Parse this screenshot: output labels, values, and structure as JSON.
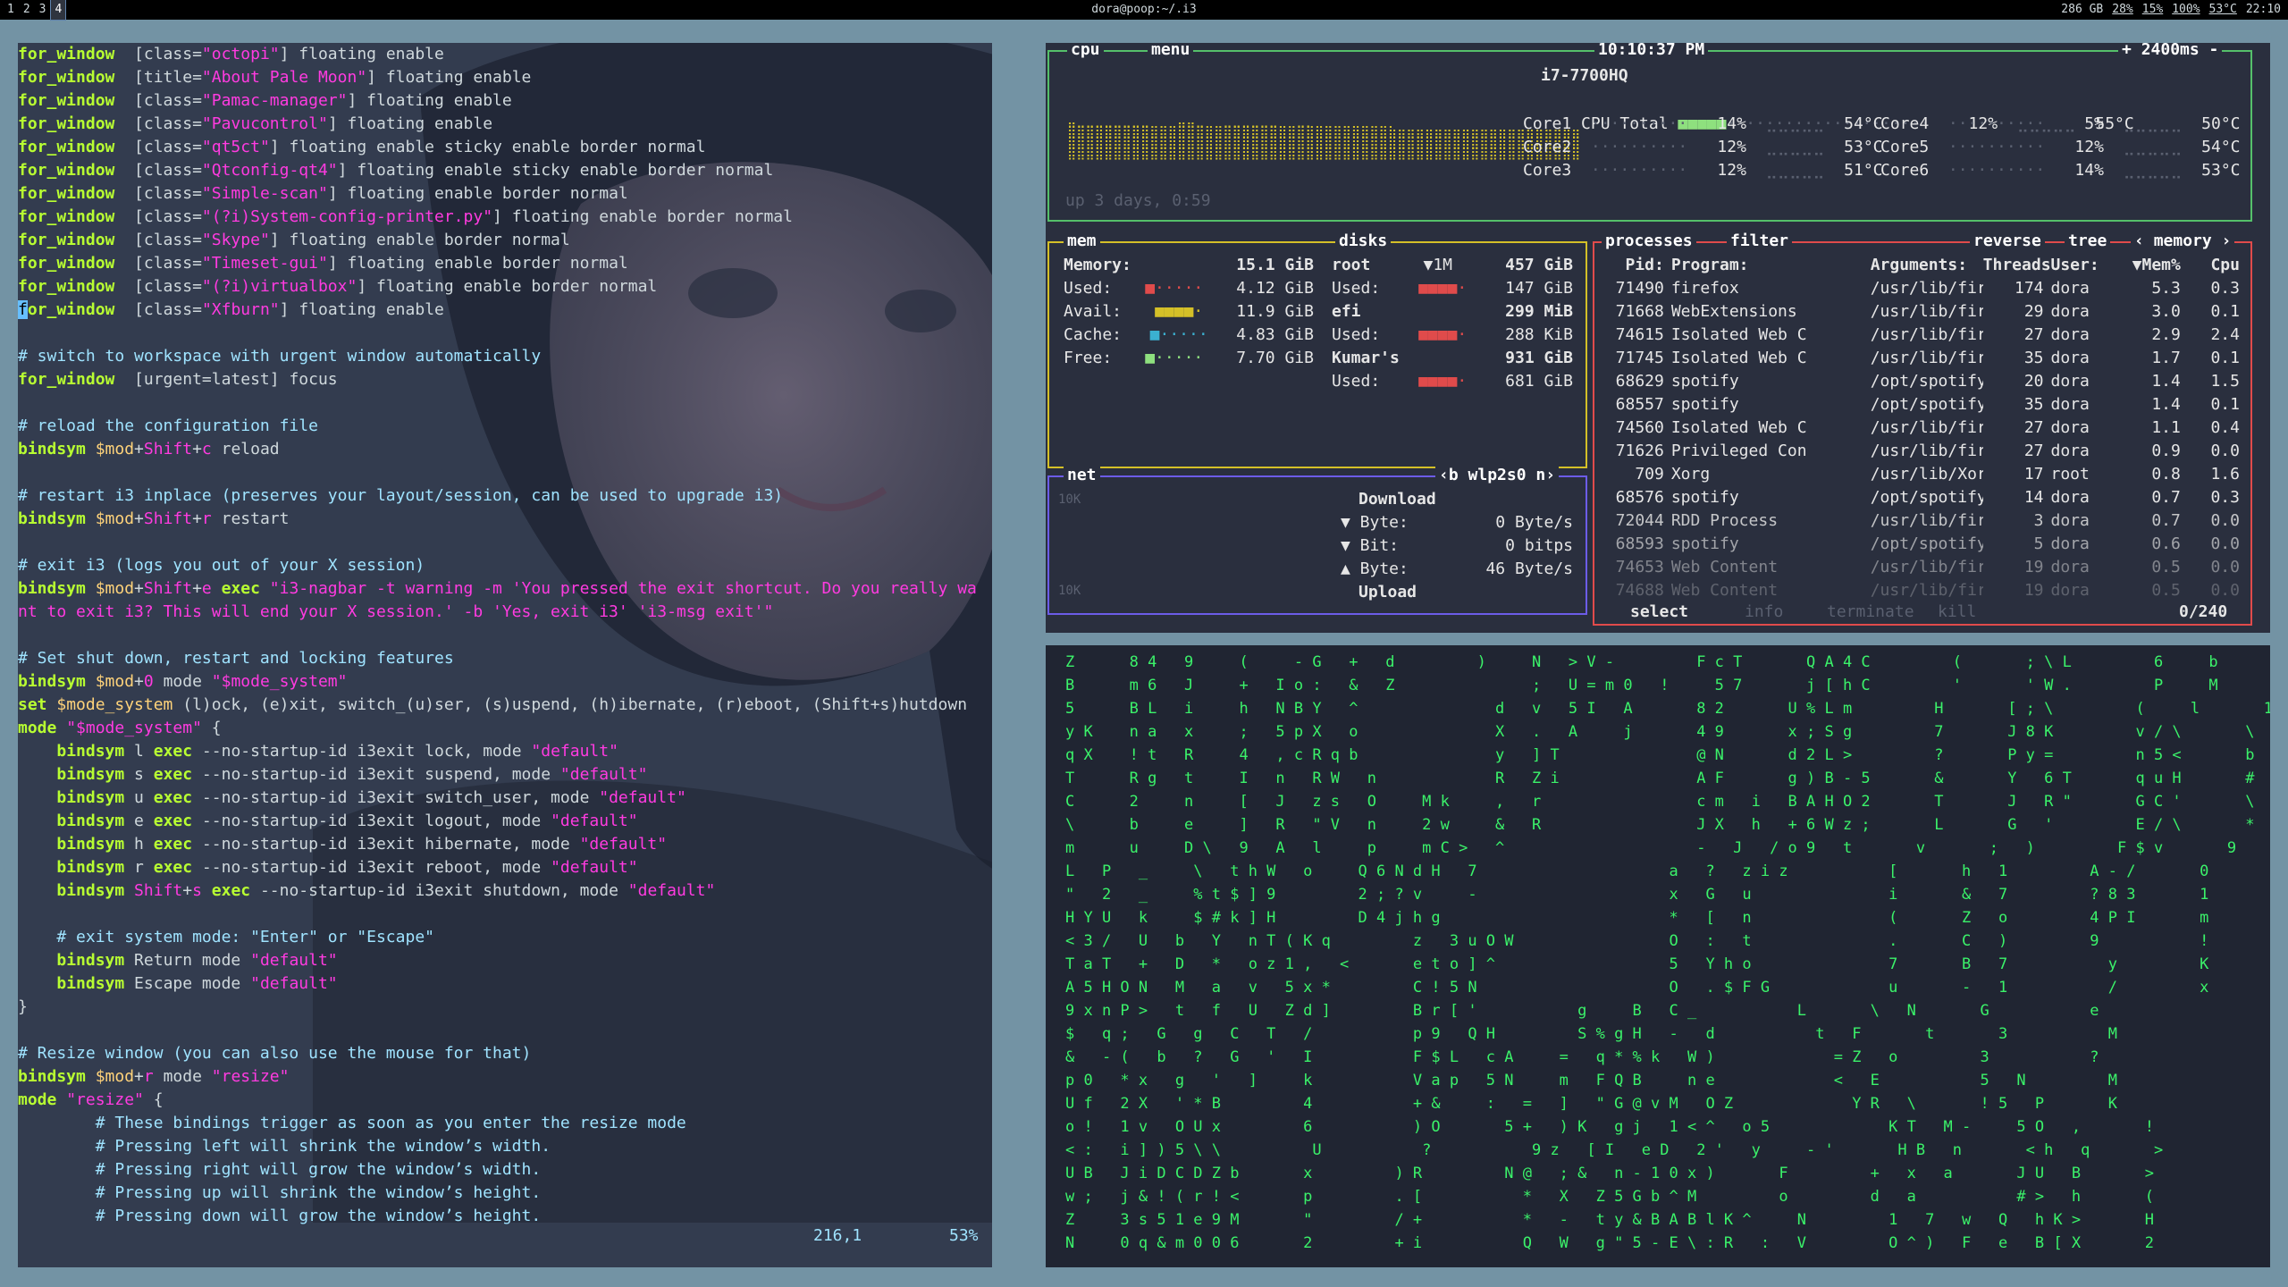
{
  "bar": {
    "workspaces": [
      "1",
      "2",
      "3",
      "4"
    ],
    "active_workspace": "4",
    "title": "dora@poop:~/.i3",
    "status": [
      "286 GB",
      "28%",
      "15%",
      "100%",
      "53°C",
      "22:10"
    ]
  },
  "editor": {
    "lines": [
      [
        [
          "kw",
          "for_window"
        ],
        [
          "",
          "  [class="
        ],
        [
          "str",
          "\"octopi\""
        ],
        [
          "",
          "] floating enable"
        ]
      ],
      [
        [
          "kw",
          "for_window"
        ],
        [
          "",
          "  [title="
        ],
        [
          "str",
          "\"About Pale Moon\""
        ],
        [
          "",
          "] floating enable"
        ]
      ],
      [
        [
          "kw",
          "for_window"
        ],
        [
          "",
          "  [class="
        ],
        [
          "str",
          "\"Pamac-manager\""
        ],
        [
          "",
          "] floating enable"
        ]
      ],
      [
        [
          "kw",
          "for_window"
        ],
        [
          "",
          "  [class="
        ],
        [
          "str",
          "\"Pavucontrol\""
        ],
        [
          "",
          "] floating enable"
        ]
      ],
      [
        [
          "kw",
          "for_window"
        ],
        [
          "",
          "  [class="
        ],
        [
          "str",
          "\"qt5ct\""
        ],
        [
          "",
          "] floating enable sticky enable border normal"
        ]
      ],
      [
        [
          "kw",
          "for_window"
        ],
        [
          "",
          "  [class="
        ],
        [
          "str",
          "\"Qtconfig-qt4\""
        ],
        [
          "",
          "] floating enable sticky enable border normal"
        ]
      ],
      [
        [
          "kw",
          "for_window"
        ],
        [
          "",
          "  [class="
        ],
        [
          "str",
          "\"Simple-scan\""
        ],
        [
          "",
          "] floating enable border normal"
        ]
      ],
      [
        [
          "kw",
          "for_window"
        ],
        [
          "",
          "  [class="
        ],
        [
          "str",
          "\"(?i)System-config-printer.py\""
        ],
        [
          "",
          "] floating enable border normal"
        ]
      ],
      [
        [
          "kw",
          "for_window"
        ],
        [
          "",
          "  [class="
        ],
        [
          "str",
          "\"Skype\""
        ],
        [
          "",
          "] floating enable border normal"
        ]
      ],
      [
        [
          "kw",
          "for_window"
        ],
        [
          "",
          "  [class="
        ],
        [
          "str",
          "\"Timeset-gui\""
        ],
        [
          "",
          "] floating enable border normal"
        ]
      ],
      [
        [
          "kw",
          "for_window"
        ],
        [
          "",
          "  [class="
        ],
        [
          "str",
          "\"(?i)virtualbox\""
        ],
        [
          "",
          "] floating enable border normal"
        ]
      ],
      [
        [
          "cursor",
          "f"
        ],
        [
          "kw",
          "or_window"
        ],
        [
          "",
          "  [class="
        ],
        [
          "str",
          "\"Xfburn\""
        ],
        [
          "",
          "] floating enable"
        ]
      ],
      [],
      [
        [
          "cm",
          "# switch to workspace with urgent window automatically"
        ]
      ],
      [
        [
          "kw",
          "for_window"
        ],
        [
          "",
          "  [urgent=latest] focus"
        ]
      ],
      [],
      [
        [
          "cm",
          "# reload the configuration file"
        ]
      ],
      [
        [
          "kw",
          "bindsym"
        ],
        [
          "var",
          " $mod"
        ],
        [
          "",
          "+"
        ],
        [
          "str",
          "Shift"
        ],
        [
          "",
          "+"
        ],
        [
          "str",
          "c"
        ],
        [
          "",
          " reload"
        ]
      ],
      [],
      [
        [
          "cm",
          "# restart i3 inplace (preserves your layout/session, can be used to upgrade i3)"
        ]
      ],
      [
        [
          "kw",
          "bindsym"
        ],
        [
          "var",
          " $mod"
        ],
        [
          "",
          "+"
        ],
        [
          "str",
          "Shift"
        ],
        [
          "",
          "+"
        ],
        [
          "str",
          "r"
        ],
        [
          "",
          " restart"
        ]
      ],
      [],
      [
        [
          "cm",
          "# exit i3 (logs you out of your X session)"
        ]
      ],
      [
        [
          "kw",
          "bindsym"
        ],
        [
          "var",
          " $mod"
        ],
        [
          "",
          "+"
        ],
        [
          "str",
          "Shift"
        ],
        [
          "",
          "+"
        ],
        [
          "str",
          "e"
        ],
        [
          "kw",
          " exec"
        ],
        [
          "str",
          " \"i3-nagbar -t warning -m 'You pressed the exit shortcut. Do you really wa"
        ]
      ],
      [
        [
          "str",
          "nt to exit i3? This will end your X session.' -b 'Yes, exit i3' 'i3-msg exit'\""
        ]
      ],
      [],
      [
        [
          "cm",
          "# Set shut down, restart and locking features"
        ]
      ],
      [
        [
          "kw",
          "bindsym"
        ],
        [
          "var",
          " $mod"
        ],
        [
          "",
          "+"
        ],
        [
          "str",
          "0"
        ],
        [
          "",
          " mode "
        ],
        [
          "str",
          "\"$mode_system\""
        ]
      ],
      [
        [
          "kw",
          "set"
        ],
        [
          "var",
          " $mode_system"
        ],
        [
          "",
          " (l)ock, (e)xit, switch_(u)ser, (s)uspend, (h)ibernate, (r)eboot, (Shift+s)hutdown"
        ]
      ],
      [
        [
          "kw",
          "mode"
        ],
        [
          "str",
          " \"$mode_system\""
        ],
        [
          "",
          " {"
        ]
      ],
      [
        [
          "",
          "    "
        ],
        [
          "kw",
          "bindsym"
        ],
        [
          "",
          " l "
        ],
        [
          "kw",
          "exec"
        ],
        [
          "",
          " --no-startup-id i3exit lock, mode "
        ],
        [
          "str",
          "\"default\""
        ]
      ],
      [
        [
          "",
          "    "
        ],
        [
          "kw",
          "bindsym"
        ],
        [
          "",
          " s "
        ],
        [
          "kw",
          "exec"
        ],
        [
          "",
          " --no-startup-id i3exit suspend, mode "
        ],
        [
          "str",
          "\"default\""
        ]
      ],
      [
        [
          "",
          "    "
        ],
        [
          "kw",
          "bindsym"
        ],
        [
          "",
          " u "
        ],
        [
          "kw",
          "exec"
        ],
        [
          "",
          " --no-startup-id i3exit switch_user, mode "
        ],
        [
          "str",
          "\"default\""
        ]
      ],
      [
        [
          "",
          "    "
        ],
        [
          "kw",
          "bindsym"
        ],
        [
          "",
          " e "
        ],
        [
          "kw",
          "exec"
        ],
        [
          "",
          " --no-startup-id i3exit logout, mode "
        ],
        [
          "str",
          "\"default\""
        ]
      ],
      [
        [
          "",
          "    "
        ],
        [
          "kw",
          "bindsym"
        ],
        [
          "",
          " h "
        ],
        [
          "kw",
          "exec"
        ],
        [
          "",
          " --no-startup-id i3exit hibernate, mode "
        ],
        [
          "str",
          "\"default\""
        ]
      ],
      [
        [
          "",
          "    "
        ],
        [
          "kw",
          "bindsym"
        ],
        [
          "",
          " r "
        ],
        [
          "kw",
          "exec"
        ],
        [
          "",
          " --no-startup-id i3exit reboot, mode "
        ],
        [
          "str",
          "\"default\""
        ]
      ],
      [
        [
          "",
          "    "
        ],
        [
          "kw",
          "bindsym"
        ],
        [
          "str",
          " Shift"
        ],
        [
          "",
          "+"
        ],
        [
          "str",
          "s"
        ],
        [
          "kw",
          " exec"
        ],
        [
          "",
          " --no-startup-id i3exit shutdown, mode "
        ],
        [
          "str",
          "\"default\""
        ]
      ],
      [],
      [
        [
          "cm",
          "    # exit system mode: \"Enter\" or \"Escape\""
        ]
      ],
      [
        [
          "",
          "    "
        ],
        [
          "kw",
          "bindsym"
        ],
        [
          "",
          " Return mode "
        ],
        [
          "str",
          "\"default\""
        ]
      ],
      [
        [
          "",
          "    "
        ],
        [
          "kw",
          "bindsym"
        ],
        [
          "",
          " Escape mode "
        ],
        [
          "str",
          "\"default\""
        ]
      ],
      [
        [
          "",
          "}"
        ]
      ],
      [],
      [
        [
          "cm",
          "# Resize window (you can also use the mouse for that)"
        ]
      ],
      [
        [
          "kw",
          "bindsym"
        ],
        [
          "var",
          " $mod"
        ],
        [
          "",
          "+"
        ],
        [
          "str",
          "r"
        ],
        [
          "",
          " mode "
        ],
        [
          "str",
          "\"resize\""
        ]
      ],
      [
        [
          "kw",
          "mode"
        ],
        [
          "str",
          " \"resize\""
        ],
        [
          "",
          " {"
        ]
      ],
      [
        [
          "cm",
          "        # These bindings trigger as soon as you enter the resize mode"
        ]
      ],
      [
        [
          "cm",
          "        # Pressing left will shrink the window’s width."
        ]
      ],
      [
        [
          "cm",
          "        # Pressing right will grow the window’s width."
        ]
      ],
      [
        [
          "cm",
          "        # Pressing up will shrink the window’s height."
        ]
      ],
      [
        [
          "cm",
          "        # Pressing down will grow the window’s height."
        ]
      ]
    ],
    "position": "216,1",
    "percent": "53%"
  },
  "bpytop": {
    "cpu": {
      "tabs": [
        "cpu",
        "menu"
      ],
      "clock": "10:10:37 PM",
      "interval": "2400ms",
      "model": "i7-7700HQ",
      "total_label": "CPU Total",
      "total_pct": "12%",
      "total_temp": "55°C",
      "cores": [
        {
          "name": "Core1",
          "pct": "14%",
          "temp": "54°C"
        },
        {
          "name": "Core2",
          "pct": "12%",
          "temp": "53°C"
        },
        {
          "name": "Core3",
          "pct": "12%",
          "temp": "51°C"
        },
        {
          "name": "Core4",
          "pct": "5%",
          "temp": "50°C"
        },
        {
          "name": "Core5",
          "pct": "12%",
          "temp": "54°C"
        },
        {
          "name": "Core6",
          "pct": "14%",
          "temp": "53°C"
        }
      ],
      "uptime": "up 3 days, 0:59"
    },
    "mem": {
      "tabs": [
        "mem",
        "disks"
      ],
      "rows": [
        [
          "Memory:",
          "15.1 GiB"
        ],
        [
          "Used:",
          "4.12 GiB"
        ],
        [
          "Avail:",
          "11.9 GiB"
        ],
        [
          "Cache:",
          "4.83 GiB"
        ],
        [
          "Free:",
          "7.70 GiB"
        ]
      ],
      "disks": [
        [
          "root",
          "▼1M",
          "457 GiB"
        ],
        [
          "Used:",
          "",
          "147 GiB"
        ],
        [
          "efi",
          "",
          "299 MiB"
        ],
        [
          "Used:",
          "",
          "288 KiB"
        ],
        [
          "Kumar's",
          "",
          "931 GiB"
        ],
        [
          "Used:",
          "",
          "681 GiB"
        ]
      ]
    },
    "net": {
      "tab": "net",
      "iface": "wlp2s0",
      "scale_top": "10K",
      "scale_bottom": "10K",
      "download": "Download",
      "upload": "Upload",
      "rows": [
        [
          "▼ Byte:",
          "0 Byte/s"
        ],
        [
          "▼ Bit:",
          "0 bitps"
        ],
        [
          "▲ Byte:",
          "46 Byte/s"
        ]
      ]
    },
    "proc": {
      "tabs": [
        "processes",
        "filter",
        "reverse",
        "tree",
        "memory"
      ],
      "headers": [
        "Pid:",
        "Program:",
        "Arguments:",
        "Threads:",
        "User:",
        "▼Mem%",
        "Cpu"
      ],
      "rows": [
        [
          "71490",
          "firefox",
          "/usr/lib/fir",
          "174",
          "dora",
          "5.3",
          "0.3"
        ],
        [
          "71668",
          "WebExtensions",
          "/usr/lib/fir",
          "29",
          "dora",
          "3.0",
          "0.1"
        ],
        [
          "74615",
          "Isolated Web C",
          "/usr/lib/fir",
          "27",
          "dora",
          "2.9",
          "2.4"
        ],
        [
          "71745",
          "Isolated Web C",
          "/usr/lib/fir",
          "35",
          "dora",
          "1.7",
          "0.1"
        ],
        [
          "68629",
          "spotify",
          "/opt/spotify",
          "20",
          "dora",
          "1.4",
          "1.5"
        ],
        [
          "68557",
          "spotify",
          "/opt/spotify",
          "35",
          "dora",
          "1.4",
          "0.1"
        ],
        [
          "74560",
          "Isolated Web C",
          "/usr/lib/fir",
          "27",
          "dora",
          "1.1",
          "0.4"
        ],
        [
          "71626",
          "Privileged Con",
          "/usr/lib/fir",
          "27",
          "dora",
          "0.9",
          "0.0"
        ],
        [
          "709",
          "Xorg",
          "/usr/lib/Xor",
          "17",
          "root",
          "0.8",
          "1.6"
        ],
        [
          "68576",
          "spotify",
          "/opt/spotify",
          "14",
          "dora",
          "0.7",
          "0.3"
        ],
        [
          "72044",
          "RDD Process",
          "/usr/lib/fir",
          "3",
          "dora",
          "0.7",
          "0.0"
        ],
        [
          "68593",
          "spotify",
          "/opt/spotify",
          "5",
          "dora",
          "0.6",
          "0.0"
        ],
        [
          "74653",
          "Web Content",
          "/usr/lib/fir",
          "19",
          "dora",
          "0.5",
          "0.0"
        ],
        [
          "74688",
          "Web Content",
          "/usr/lib/fir",
          "19",
          "dora",
          "0.5",
          "0.0"
        ]
      ],
      "footer": [
        "select",
        "info",
        "terminate",
        "kill"
      ],
      "count": "0/240"
    }
  },
  "matrix": {
    "lines": [
      "Z      8 4   9     (     - G   +   d         )     N   > V -         F c T       Q A 4 C         (       ; \\ L         6     b       t",
      "B      m 6   J     +   I o :   &   Z               ;   U = m 0   !     5 7       j [ h C         '       ' W .         P     M       m",
      "5      B L   i     h   N B Y   ^               d   v   5 I   A       8 2       U % L m         H       [ ; \\         (     l       1",
      "y K    n a   x     ;   5 p X   o               X   .   A     j       4 9       x ; S g         7       J 8 K         v / \\       \\",
      "q X    ! t   R     4   , c R q b               y   ] T               @ N       d 2 L >         ?       P y =         n 5 <       b",
      "T      R g   t     I   n   R W   n             R   Z i               A F       g ) B - 5       &       Y   6 T       q u H       #",
      "C      2     n     [   J   z s   O     M k     ,   r                 c m   i   B A H O 2       T       J   R \"       G C '       \\",
      "\\      b     e     ]   R   \" V   n     2 w     &   R                 J X   h   + 6 W z ;       L       G   '         E / \\       *",
      "m      u     D \\   9   A   l     p     m C >   ^                     -   J   / o 9   t       v       ;   )         F $ v       9",
      "L   P   _     \\   t h W   o     Q 6 N d H   7                     a   ?   z i z           [       h   1         A - /       0",
      "\"   2   _     % t $ ] 9         2 ; ? v     -                     x   G   u               i       &   7         ? 8 3       1",
      "H Y U   k     $ # k ] H         D 4 j h g                         *   [   n               (       Z   o         4 P I       m",
      "< 3 /   U   b   Y   n T ( K q         z   3 u O W                 O   :   t               .       C   )         9           !",
      "T a T   +   D   *   o z 1 ,   <       e t o ] ^                   5   Y h o               7       B   7           y         K",
      "A 5 H O N   M   a   v   5 x *         C ! 5 N                     O   . $ F G             u       -   1           /         x",
      "9 x n P >   t   f   U   Z d ]         B r [ '           g     B   C _           L       \\   N       G           e",
      "$   q ;   G   g   C   T   /           p 9   Q H         S % g H   -   d           t   F       t       3           M",
      "&   - (   b   ?   G   '   I           F $ L   c A     =   q * % k   W )             = Z   o         3           ?",
      "p 0   * x   g   '   ]     k           V a p   5 N     m   F Q B     n e             <   E           5   N         M",
      "U f   2 X   ' * B         4           + &     :   =   ]   \" G @ v M   O Z             Y R   \\       ! 5   P       K",
      "o !   1 v   O U x         6           ) O       5 +   ) K   g j   1 < ^   o 5             K T   M -     5 O   ,       !",
      "< :   i ] ) 5 \\ \\          U           ?           9 z   [ I   e D   2 '   y     - '       H B   n       < h   q       >",
      "U B   J i D C D Z b       x         ) R         N @   ; &   n - 1 0 x )       F         +   x   a       J U   B       >",
      "w ;   j & ! ( r ! <       p         . [           *   X   Z 5 G b ^ M         o         d   a           # >   h       (",
      "Z     3 s 5 1 e 9 M       \"         / +           *   -   t y & B A B l K ^     N         1   7   w   Q   h K >       H",
      "N     0 q & m 0 0 6       2         + i           Q   W   g \" 5 - E \\ : R   :   V         O ^ )   F   e   B [ X       2"
    ]
  }
}
